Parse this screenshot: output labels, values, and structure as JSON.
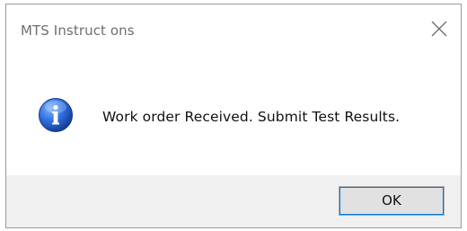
{
  "window": {
    "title": "MTS Instruct ons"
  },
  "dialog": {
    "icon": "information-icon",
    "message": "Work order Received. Submit Test Results."
  },
  "buttons": {
    "ok_label": "OK"
  },
  "colors": {
    "footer_bg": "#f0f0f0",
    "icon_blue": "#1f5fd1",
    "focus_outline": "#0078d7"
  }
}
